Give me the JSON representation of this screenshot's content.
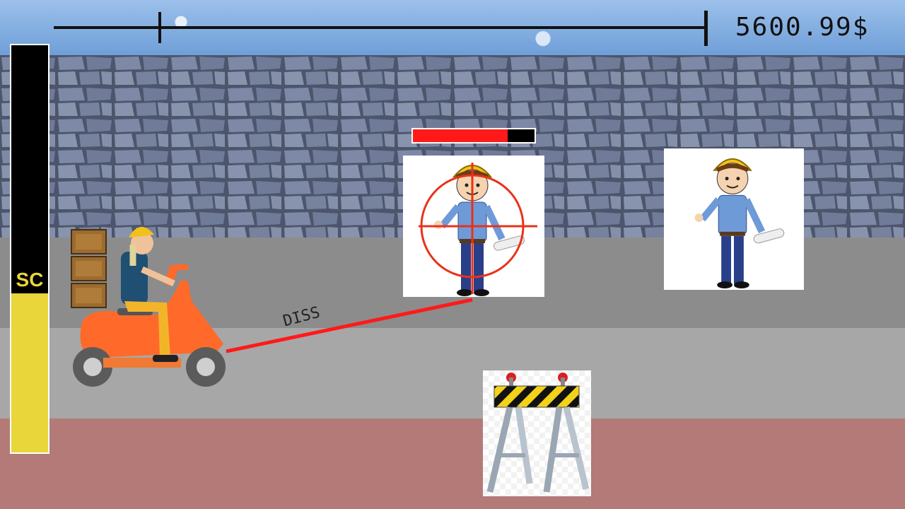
{
  "hud": {
    "money_text": "5600.99$",
    "route_progress": 0.16,
    "sc_label": "SC",
    "sc_fill_fraction": 0.39
  },
  "targets": [
    {
      "name": "worker-targeted",
      "health_fraction": 0.78,
      "targeted": true
    },
    {
      "name": "worker-idle",
      "targeted": false
    }
  ],
  "attack": {
    "label": "DISS"
  },
  "colors": {
    "sc_yellow": "#e8d63a",
    "laser_red": "#ff1a1a",
    "sky_blue": "#8fb6e6",
    "wall_gray": "#5f6b85",
    "road_gray": "#9a9a9a",
    "sidewalk_red": "#b37a78"
  }
}
